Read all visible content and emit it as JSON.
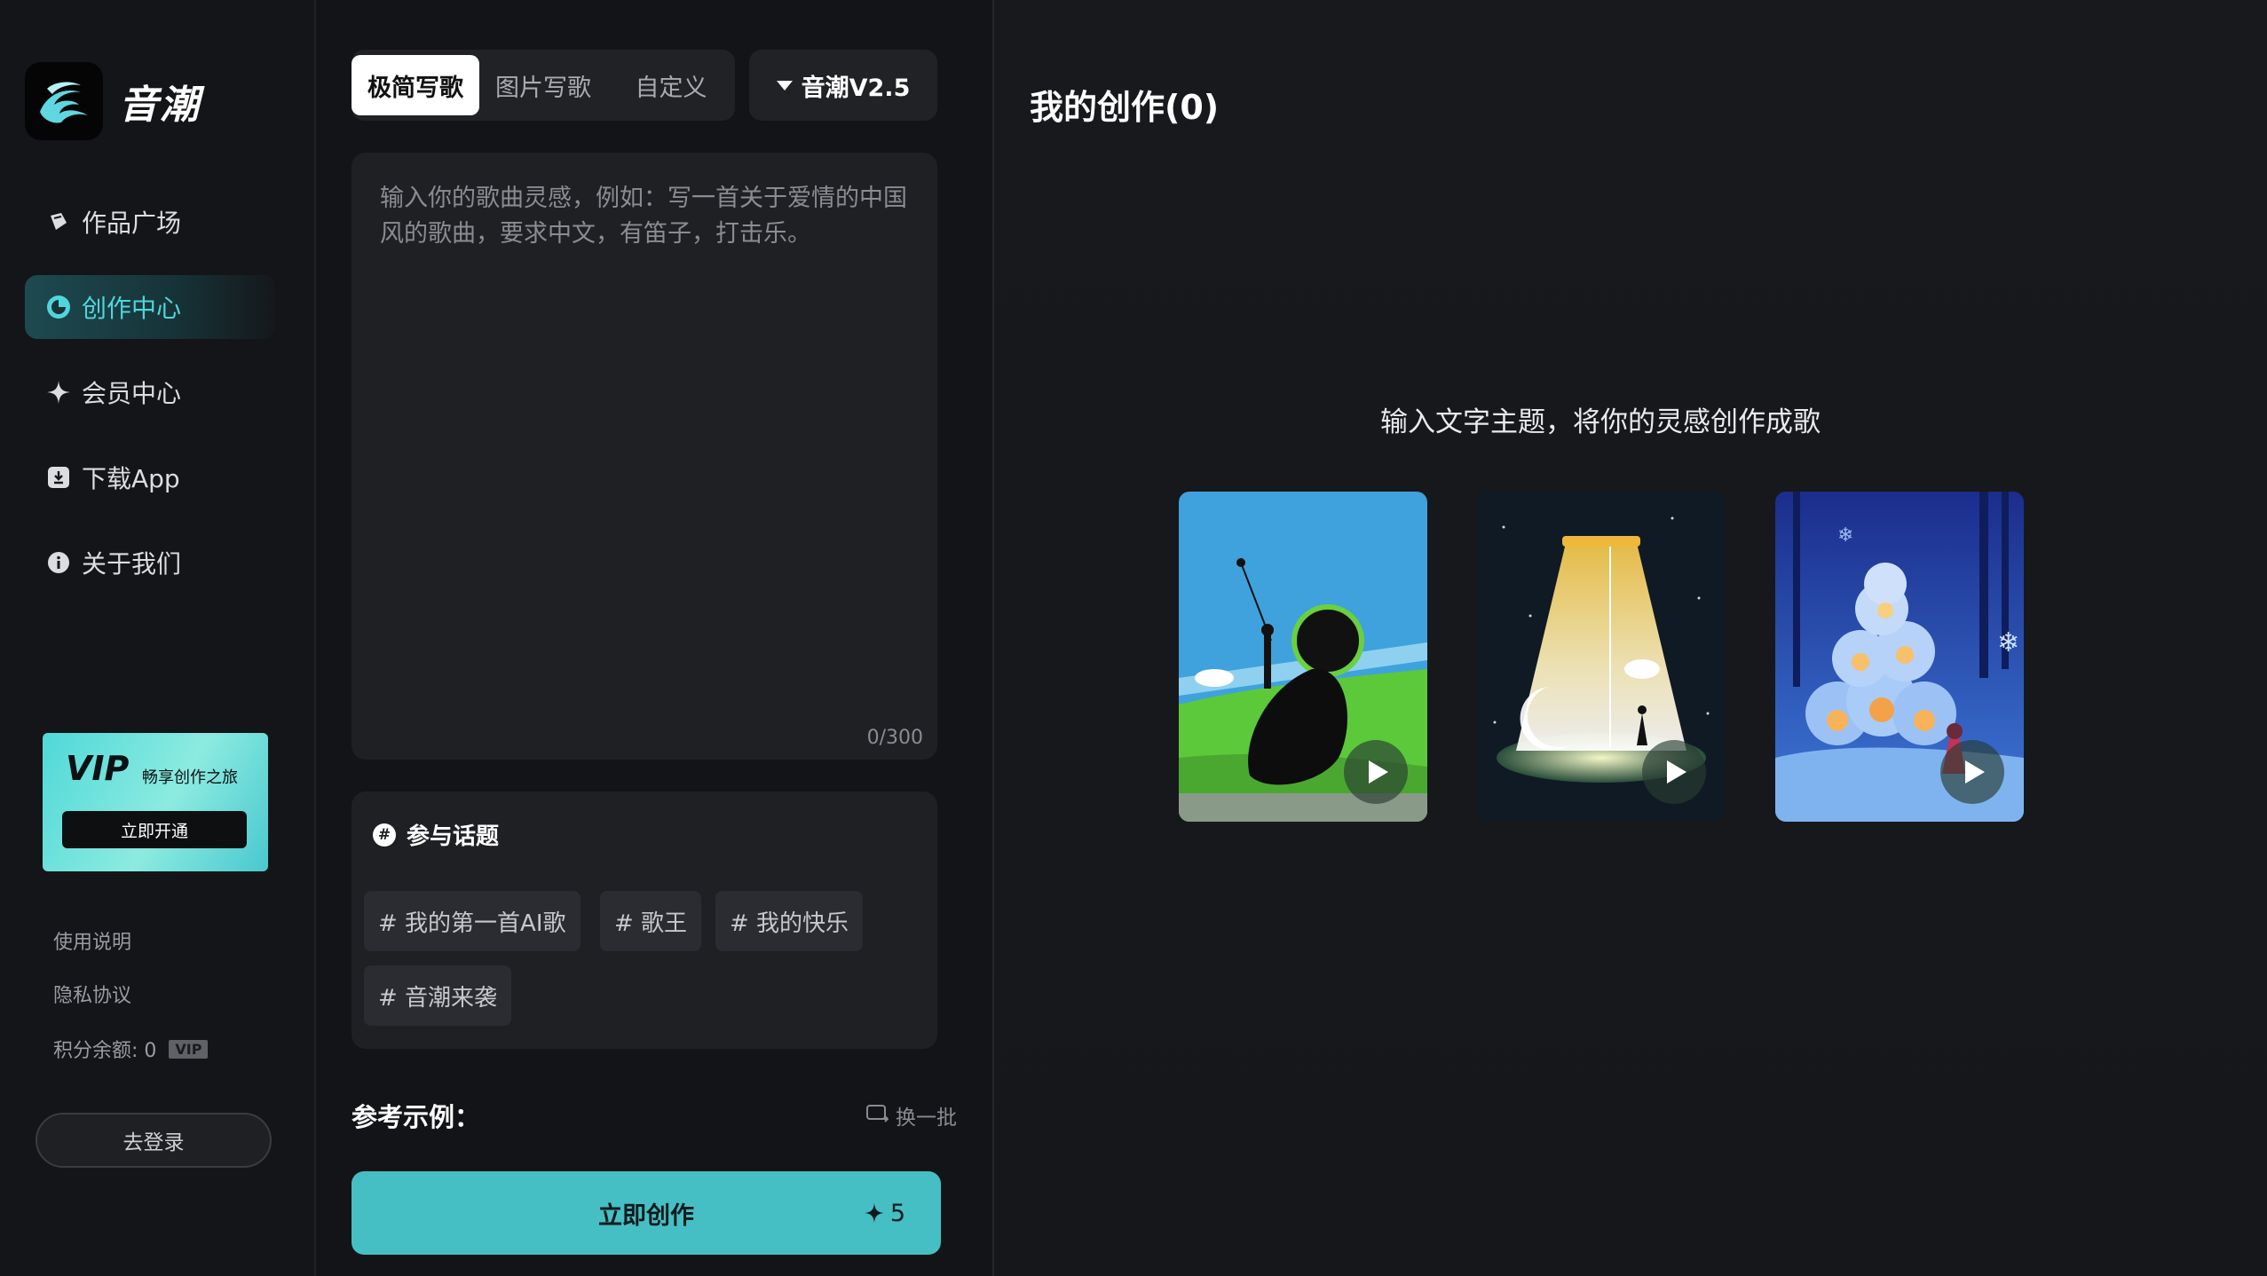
{
  "app": {
    "name": "音潮"
  },
  "sidebar": {
    "items": [
      {
        "label": "作品广场",
        "icon": "plaza-icon"
      },
      {
        "label": "创作中心",
        "icon": "create-icon",
        "active": true
      },
      {
        "label": "会员中心",
        "icon": "sparkle-icon"
      },
      {
        "label": "下载App",
        "icon": "download-icon"
      },
      {
        "label": "关于我们",
        "icon": "info-icon"
      }
    ],
    "vip_card": {
      "badge": "VIP",
      "slogan": "畅享创作之旅",
      "button": "立即开通"
    },
    "links": {
      "usage": "使用说明",
      "privacy": "隐私协议"
    },
    "credits": {
      "label": "积分余额: 0",
      "badge": "VIP"
    },
    "login_button": "去登录"
  },
  "composer": {
    "tabs": [
      {
        "label": "极简写歌",
        "active": true
      },
      {
        "label": "图片写歌"
      },
      {
        "label": "自定义"
      }
    ],
    "version": "音潮V2.5",
    "prompt": {
      "value": "",
      "placeholder": "输入你的歌曲灵感，例如：写一首关于爱情的中国风的歌曲，要求中文，有笛子，打击乐。",
      "count": "0/300"
    },
    "topics": {
      "title": "参与话题",
      "tags": [
        "# 我的第一首AI歌",
        "# 歌王",
        "# 我的快乐",
        "# 音潮来袭"
      ]
    },
    "examples": {
      "label": "参考示例：",
      "refresh": "换一批"
    },
    "create_button": {
      "label": "立即创作",
      "cost": "5"
    }
  },
  "gallery": {
    "title": "我的创作(0)",
    "hint": "输入文字主题，将你的灵感创作成歌",
    "cards": [
      {
        "name": "sample-card-meadow"
      },
      {
        "name": "sample-card-lamp"
      },
      {
        "name": "sample-card-snow"
      }
    ]
  },
  "colors": {
    "accent": "#45bfc4",
    "active_nav": "#4fd6dc",
    "background": "#15171b"
  }
}
